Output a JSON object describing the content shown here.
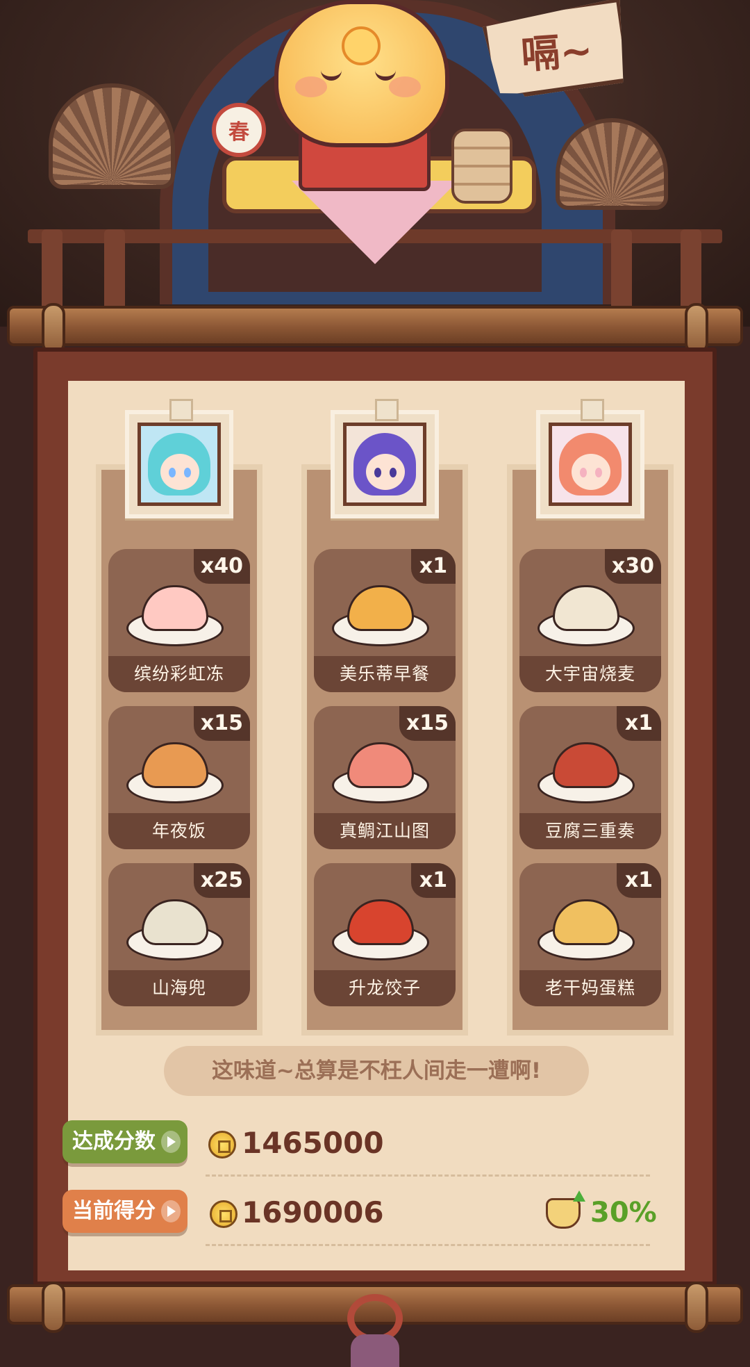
{
  "scene": {
    "speech_text": "嗝~",
    "drum_text": "春"
  },
  "characters": [
    {
      "name": "character-1",
      "hair_color": "#5fd0d8",
      "accent": "#7ab6ff"
    },
    {
      "name": "character-2",
      "hair_color": "#6b54c8",
      "accent": "#4a3a9a"
    },
    {
      "name": "character-3",
      "hair_color": "#f28a6e",
      "accent": "#f5b2c0"
    }
  ],
  "dishes": [
    [
      {
        "name": "缤纷彩虹冻",
        "count": "x40",
        "food_color": "#ffc9c2"
      },
      {
        "name": "年夜饭",
        "count": "x15",
        "food_color": "#e89a52"
      },
      {
        "name": "山海兜",
        "count": "x25",
        "food_color": "#e9e2cf"
      }
    ],
    [
      {
        "name": "美乐蒂早餐",
        "count": "x1",
        "food_color": "#f2b04a"
      },
      {
        "name": "真鲷江山图",
        "count": "x15",
        "food_color": "#f08a7a"
      },
      {
        "name": "升龙饺子",
        "count": "x1",
        "food_color": "#d8442e"
      }
    ],
    [
      {
        "name": "大宇宙烧麦",
        "count": "x30",
        "food_color": "#f1e6d2"
      },
      {
        "name": "豆腐三重奏",
        "count": "x1",
        "food_color": "#c94a36"
      },
      {
        "name": "老干妈蛋糕",
        "count": "x1",
        "food_color": "#f0c060"
      }
    ]
  ],
  "quote": "这味道~总算是不枉人间走一遭啊!",
  "target": {
    "label": "达成分数",
    "score": "1465000",
    "color": "#7a9a3c"
  },
  "current": {
    "label": "当前得分",
    "score": "1690006",
    "color": "#e0804a"
  },
  "bonus_percent": "30%"
}
